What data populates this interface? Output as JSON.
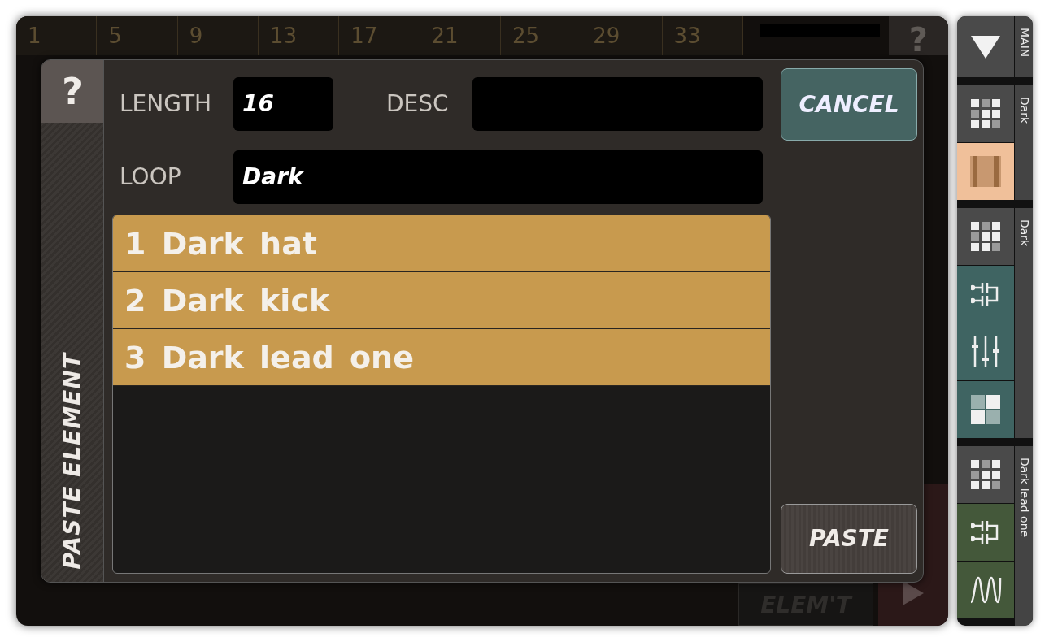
{
  "ruler": {
    "marks": [
      "1",
      "5",
      "9",
      "13",
      "17",
      "21",
      "25",
      "29",
      "33"
    ]
  },
  "background": {
    "help_button": "?",
    "delete_button": "ELEM'T"
  },
  "dialog": {
    "help": "?",
    "title": "PASTE ELEMENT",
    "length": {
      "label": "LENGTH",
      "value": "16"
    },
    "desc": {
      "label": "DESC"
    },
    "loop": {
      "label": "LOOP",
      "value": "Dark"
    },
    "items": [
      {
        "text": "1 Dark hat"
      },
      {
        "text": "2 Dark kick"
      },
      {
        "text": "3 Dark lead one"
      }
    ],
    "cancel": "CANCEL",
    "paste": "PASTE"
  },
  "sidebar": {
    "groups": [
      {
        "label": "MAIN",
        "tiles": [
          {
            "kind": "dropdown",
            "color": "#4a4a4a"
          }
        ]
      },
      {
        "label": "Dark",
        "tiles": [
          {
            "kind": "grid",
            "color": "#4a4a4a"
          },
          {
            "kind": "tracks",
            "color": "#f0c09a"
          }
        ]
      },
      {
        "label": "Dark",
        "tiles": [
          {
            "kind": "grid",
            "color": "#4a4a4a"
          },
          {
            "kind": "connector",
            "color": "#3f6462"
          },
          {
            "kind": "sliders",
            "color": "#3f6462"
          },
          {
            "kind": "squares",
            "color": "#3f6462"
          }
        ]
      },
      {
        "label": "Dark lead one",
        "tiles": [
          {
            "kind": "grid",
            "color": "#4a4a4a"
          },
          {
            "kind": "connector",
            "color": "#44583a"
          },
          {
            "kind": "wave",
            "color": "#44583a"
          }
        ]
      }
    ]
  }
}
